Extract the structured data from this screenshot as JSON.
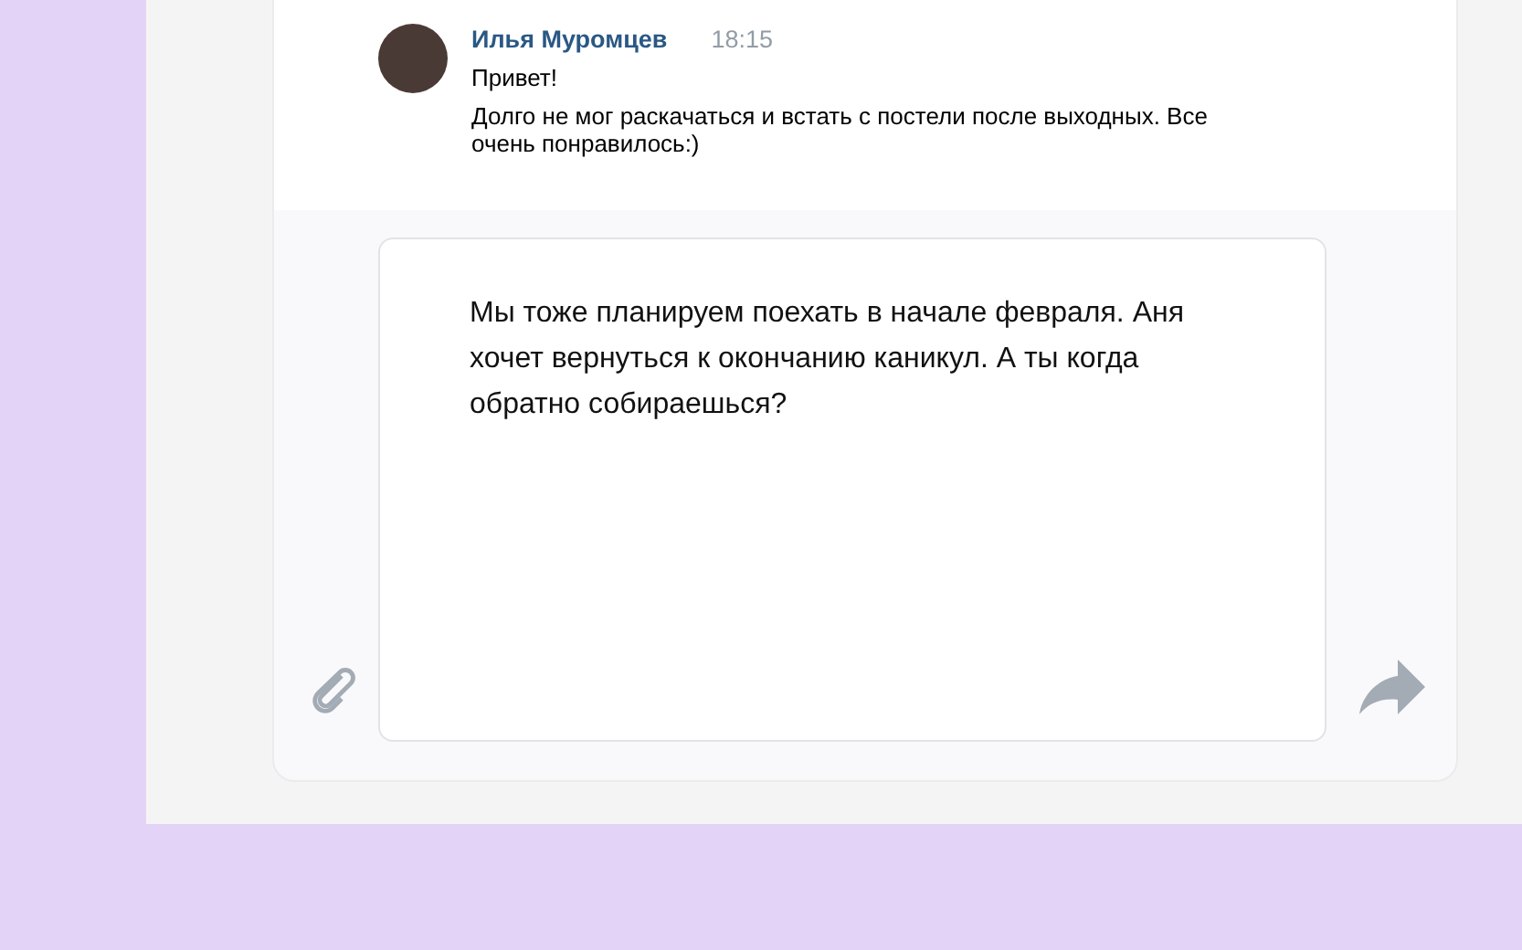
{
  "message": {
    "author": "Илья Муромцев",
    "time": "18:15",
    "lines": [
      "Привет!",
      "Долго не мог раскачаться и встать с постели после выходных. Все очень понравилось:)"
    ]
  },
  "composer": {
    "value": "Мы тоже планируем поехать в начале февраля. Аня хочет вернуться к окончанию каникул. А ты когда обратно собираешься?"
  }
}
